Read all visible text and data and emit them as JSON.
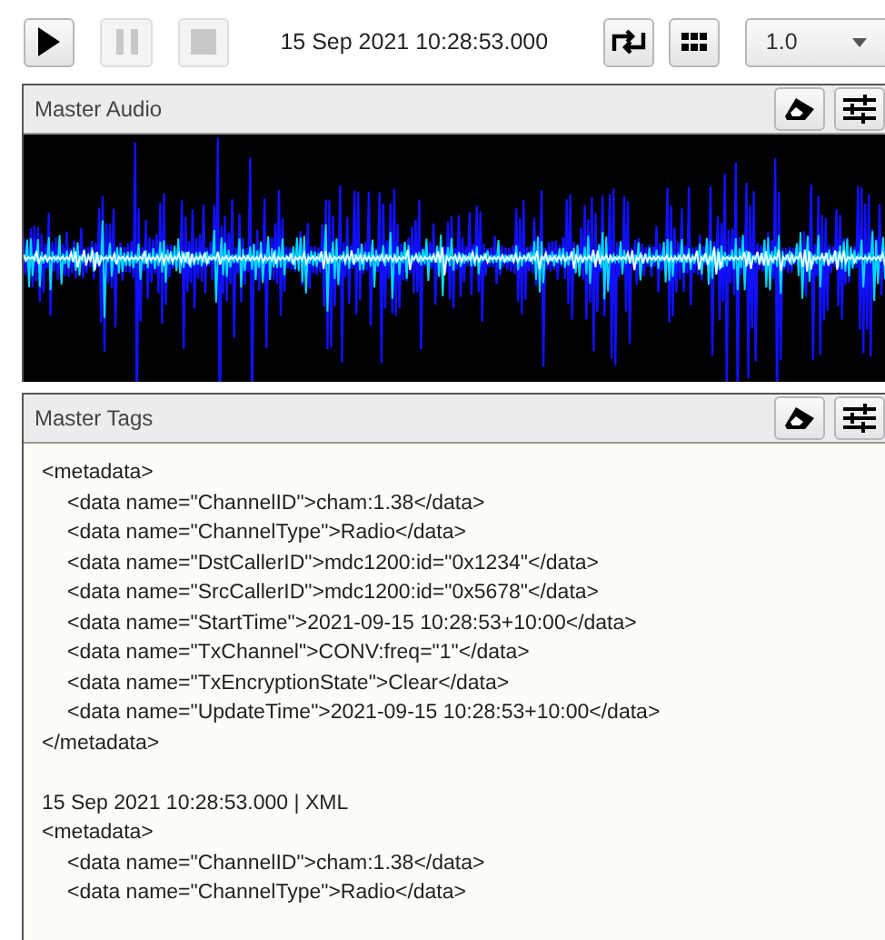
{
  "toolbar": {
    "buttons": [
      {
        "kind": "play",
        "disabled": false
      },
      {
        "kind": "pause",
        "disabled": true
      },
      {
        "kind": "stop",
        "disabled": true
      }
    ],
    "timestamp": "15 Sep 2021 10:28:53.000",
    "tools": [
      {
        "kind": "repeat"
      },
      {
        "kind": "grid"
      }
    ],
    "speed": {
      "value": "1.0"
    }
  },
  "audio_panel": {
    "title": "Master Audio"
  },
  "tags_panel": {
    "title": "Master Tags",
    "lines": [
      {
        "kind": "tag",
        "text": "<metadata>",
        "children": [
          {
            "text": "<data name=\"ChannelID\">cham:1.38</data>"
          },
          {
            "text": "<data name=\"ChannelType\">Radio</data>"
          },
          {
            "text": "<data name=\"DstCallerID\">mdc1200:id=\"0x1234\"</data>"
          },
          {
            "text": "<data name=\"SrcCallerID\">mdc1200:id=\"0x5678\"</data>"
          },
          {
            "text": "<data name=\"StartTime\">2021-09-15 10:28:53+10:00</data>"
          },
          {
            "text": "<data name=\"TxChannel\">CONV:freq=\"1\"</data>"
          },
          {
            "text": "<data name=\"TxEncryptionState\">Clear</data>"
          },
          {
            "text": "<data name=\"UpdateTime\">2021-09-15 10:28:53+10:00</data>"
          }
        ]
      },
      {
        "kind": "tag",
        "text": "</metadata>"
      },
      {
        "kind": "header",
        "text": "15 Sep 2021 10:28:53.000 | XML"
      },
      {
        "kind": "tag",
        "text": "<metadata>",
        "children": [
          {
            "text": "<data name=\"ChannelID\">cham:1.38</data>"
          },
          {
            "text": "<data name=\"ChannelType\">Radio</data>"
          }
        ]
      }
    ]
  }
}
